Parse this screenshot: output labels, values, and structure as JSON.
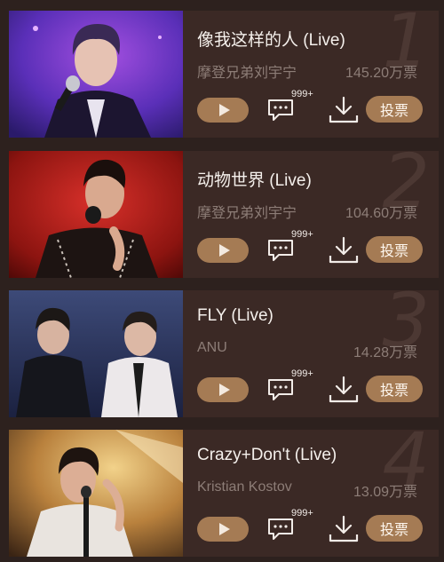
{
  "songs": [
    {
      "rank": "1",
      "title": "像我这样的人 (Live)",
      "artist": "摩登兄弟刘宇宁",
      "votes": "145.20万票",
      "comment_badge": "999+",
      "vote_label": "投票",
      "thumbnail": "performer-purple-stage"
    },
    {
      "rank": "2",
      "title": "动物世界 (Live)",
      "artist": "摩登兄弟刘宇宁",
      "votes": "104.60万票",
      "comment_badge": "999+",
      "vote_label": "投票",
      "thumbnail": "performer-red-stage"
    },
    {
      "rank": "3",
      "title": "FLY (Live)",
      "artist": "ANU",
      "votes": "14.28万票",
      "comment_badge": "999+",
      "vote_label": "投票",
      "thumbnail": "duo-blue-stage"
    },
    {
      "rank": "4",
      "title": "Crazy+Don't (Live)",
      "artist": "Kristian Kostov",
      "votes": "13.09万票",
      "comment_badge": "999+",
      "vote_label": "投票",
      "thumbnail": "performer-golden-stage"
    }
  ],
  "colors": {
    "background": "#2d211e",
    "card": "#3b2925",
    "accent_button": "#a57b54",
    "muted_text": "#8d7d77",
    "rank_number": "#4c3833"
  },
  "icons": [
    "play-icon",
    "comment-icon",
    "download-icon"
  ]
}
